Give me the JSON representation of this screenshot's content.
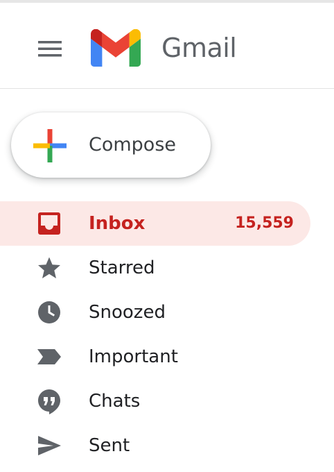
{
  "header": {
    "app_name": "Gmail",
    "menu_icon": "hamburger-menu-icon",
    "logo_icon": "gmail-logo-icon"
  },
  "compose": {
    "label": "Compose",
    "icon": "plus-icon"
  },
  "nav": {
    "items": [
      {
        "label": "Inbox",
        "count": "15,559",
        "icon": "inbox-icon",
        "active": true
      },
      {
        "label": "Starred",
        "icon": "star-icon"
      },
      {
        "label": "Snoozed",
        "icon": "clock-icon"
      },
      {
        "label": "Important",
        "icon": "important-icon"
      },
      {
        "label": "Chats",
        "icon": "chat-icon"
      },
      {
        "label": "Sent",
        "icon": "send-icon"
      }
    ]
  },
  "colors": {
    "active_text": "#c5221f",
    "active_background": "#fce8e6",
    "icon_gray": "#5f6368",
    "gmail_red": "#ea4335",
    "gmail_blue": "#4285f4",
    "gmail_green": "#34a853",
    "gmail_yellow": "#fbbc04"
  }
}
